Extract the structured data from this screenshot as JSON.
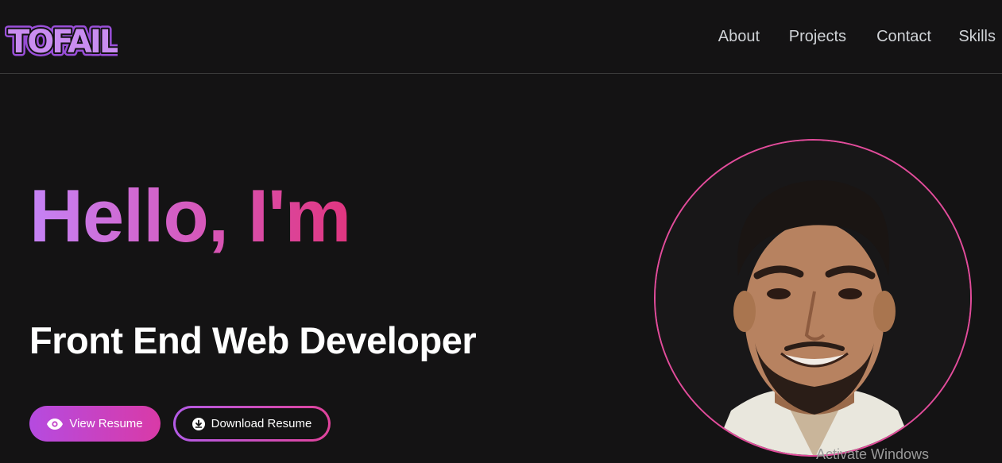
{
  "header": {
    "logo_text": "TOFAIL",
    "nav": [
      {
        "label": "About"
      },
      {
        "label": "Projects"
      },
      {
        "label": "Contact"
      },
      {
        "label": "Skills"
      }
    ]
  },
  "hero": {
    "greeting": "Hello, I'm",
    "role": "Front End Web Developer",
    "view_resume_label": "View Resume",
    "download_resume_label": "Download Resume"
  },
  "avatar": {
    "icon": "profile-photo"
  },
  "watermark": {
    "text": "Activate Windows"
  },
  "colors": {
    "background": "#141314",
    "accent_purple": "#c583f6",
    "accent_pink": "#e0357f",
    "avatar_ring": "#e24c9b"
  }
}
